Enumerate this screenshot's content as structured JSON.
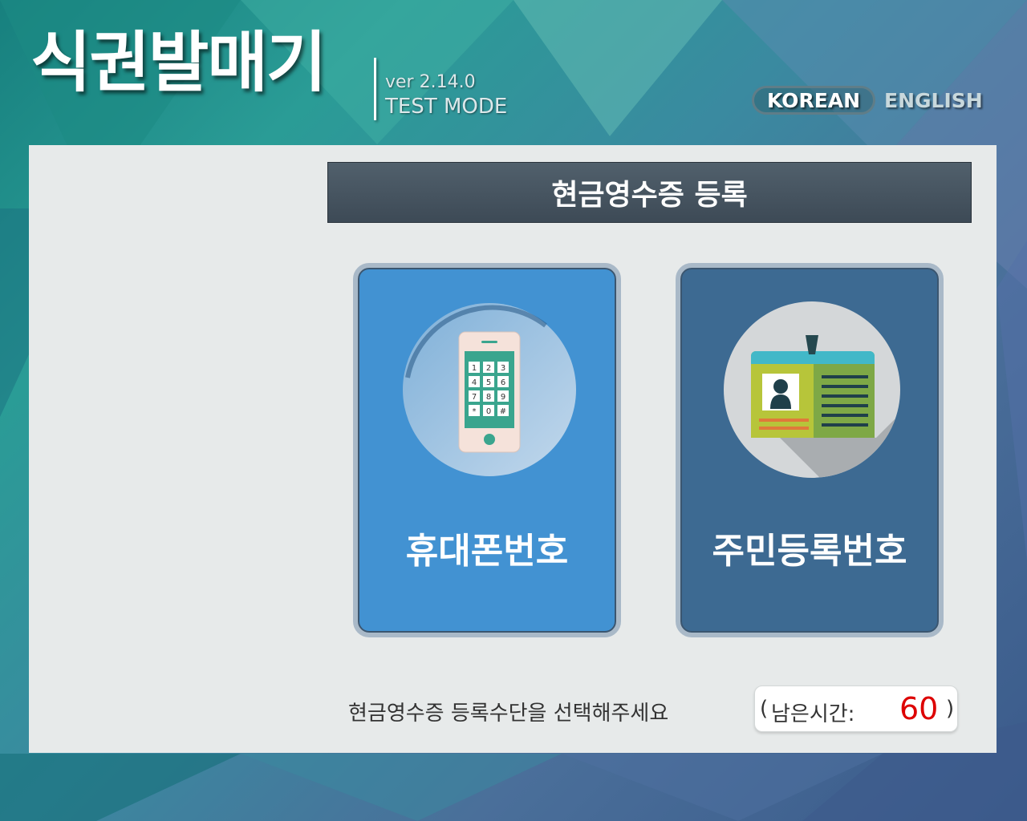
{
  "app": {
    "title": "식권발매기",
    "version": "ver 2.14.0",
    "mode": "TEST MODE"
  },
  "language": {
    "korean": "KOREAN",
    "english": "ENGLISH"
  },
  "main": {
    "header": "현금영수증 등록",
    "options": [
      {
        "label": "휴대폰번호",
        "icon": "mobile-phone-icon"
      },
      {
        "label": "주민등록번호",
        "icon": "id-card-icon"
      }
    ],
    "instruction": "현금영수증 등록수단을 선택해주세요",
    "timer": {
      "open": "(",
      "label": "남은시간:",
      "value": "60",
      "close": ")"
    },
    "keypad": [
      "1",
      "2",
      "3",
      "4",
      "5",
      "6",
      "7",
      "8",
      "9",
      "*",
      "0",
      "#"
    ]
  },
  "colors": {
    "phone_card": "#4292d2",
    "id_card": "#3d6a92",
    "header_bar": "#46535f",
    "timer_value": "#dd0000"
  }
}
